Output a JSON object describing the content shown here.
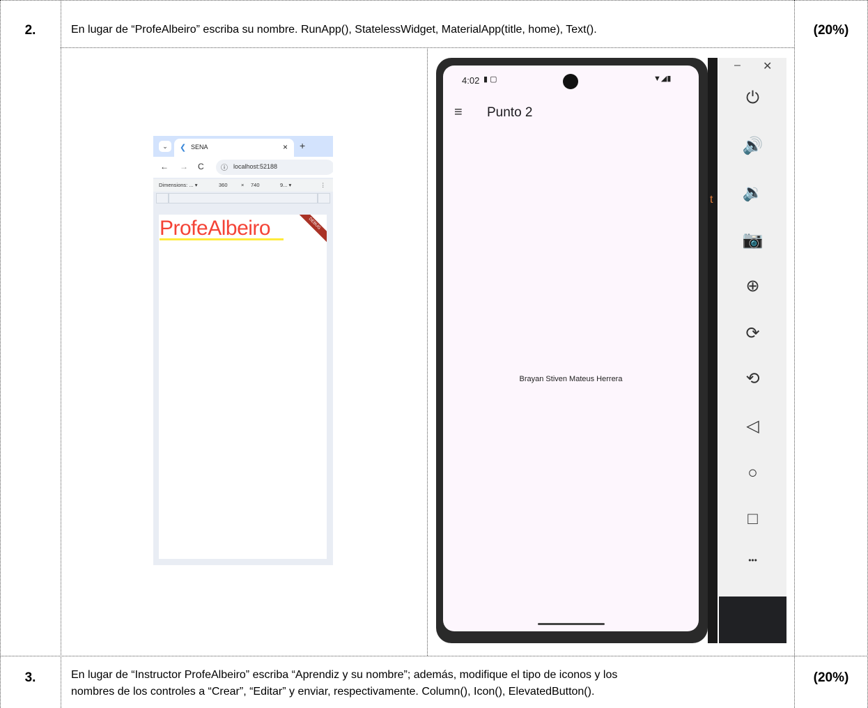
{
  "q2": {
    "number": "2.",
    "text": "En lugar de “ProfeAlbeiro” escriba su nombre. RunApp(), StatelessWidget, MaterialApp(title, home), Text().",
    "percent": "(20%)"
  },
  "q3": {
    "number": "3.",
    "line1": "En lugar de “Instructor ProfeAlbeiro” escriba “Aprendiz y su nombre”; además, modifique el tipo de iconos y los",
    "line2": "nombres de los controles a “Crear”, “Editar” y enviar, respectivamente. Column(), Icon(), ElevatedButton().",
    "percent": "(20%)"
  },
  "browser": {
    "tab_title": "SENA",
    "url": "localhost:52188",
    "dimensions_label": "Dimensions: ...",
    "width": "360",
    "times": "×",
    "height": "740",
    "zoom": "9...",
    "app_text": "ProfeAlbeiro",
    "debug_banner": "DEBUG"
  },
  "phone": {
    "time": "4:02",
    "app_title": "Punto 2",
    "center_text": "Brayan Stiven Mateus Herrera"
  },
  "emulator": {
    "tools": [
      {
        "icon": "power-icon",
        "glyph": "⏻"
      },
      {
        "icon": "volume-up-icon",
        "glyph": "🔊"
      },
      {
        "icon": "volume-down-icon",
        "glyph": "🔉"
      },
      {
        "icon": "camera-icon",
        "glyph": "📷"
      },
      {
        "icon": "zoom-in-icon",
        "glyph": "⊕"
      },
      {
        "icon": "rotate-right-icon",
        "glyph": "⟳"
      },
      {
        "icon": "rotate-left-icon",
        "glyph": "⟲"
      },
      {
        "icon": "back-icon",
        "glyph": "◁"
      },
      {
        "icon": "home-icon",
        "glyph": "○"
      },
      {
        "icon": "overview-icon",
        "glyph": "□"
      },
      {
        "icon": "more-icon",
        "glyph": "•••"
      }
    ]
  }
}
